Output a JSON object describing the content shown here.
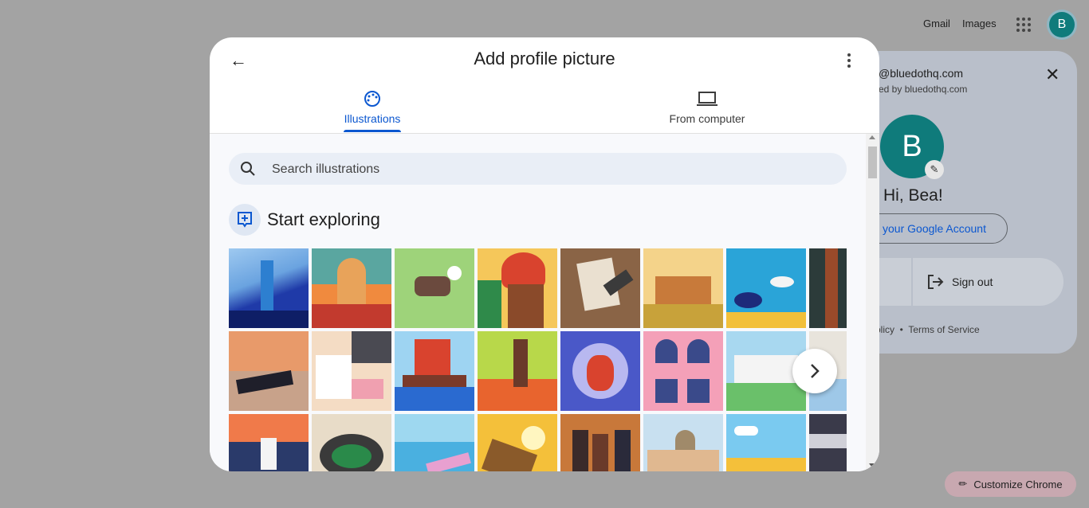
{
  "topbar": {
    "gmail": "Gmail",
    "images": "Images",
    "avatar_letter": "B"
  },
  "account_panel": {
    "email": "@bluedothq.com",
    "managed": "ed by bluedothq.com",
    "avatar_letter": "B",
    "greeting": "Hi, Bea!",
    "manage_label": "your Google Account",
    "signout_label": "Sign out",
    "footer": "olicy  •  Terms of Service"
  },
  "dialog": {
    "title": "Add profile picture",
    "tabs": [
      {
        "label": "Illustrations",
        "icon": "palette-icon",
        "selected": true
      },
      {
        "label": "From computer",
        "icon": "laptop-icon",
        "selected": false
      }
    ],
    "search": {
      "placeholder": "Search illustrations"
    },
    "section_title": "Start exploring",
    "tiles": [
      "flashlight",
      "meerkat",
      "dog",
      "woman-headwrap",
      "quill-letter",
      "memorial",
      "coral-fish",
      "forest",
      "beach-volleyball",
      "laptop-desk",
      "junk-boat",
      "runner",
      "bull",
      "windows-flowers",
      "stadium-building",
      "partial",
      "skier",
      "stadium",
      "surfers",
      "eagle",
      "musicians",
      "cathedral",
      "mountains",
      "piano"
    ]
  },
  "customize_chrome": "Customize Chrome",
  "colors": {
    "accent": "#0b57d0",
    "avatar": "#0f7b7b",
    "scrim": "#a3a3a3"
  }
}
